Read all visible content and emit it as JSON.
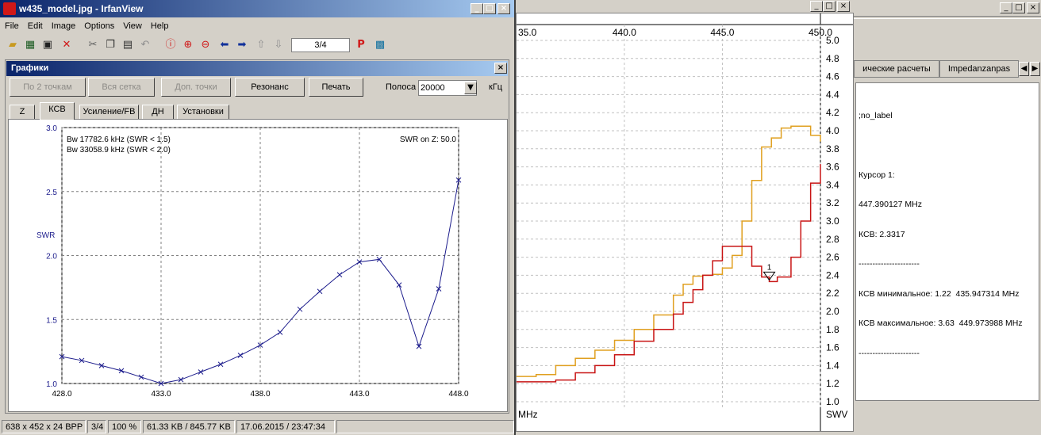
{
  "main_window": {
    "title": "w435_model.jpg - IrfanView",
    "menu": [
      "File",
      "Edit",
      "Image",
      "Options",
      "View",
      "Help"
    ],
    "toolbar": {
      "page_counter": "3/4",
      "icons": [
        "open-icon",
        "thumbnails-icon",
        "save-icon",
        "delete-icon",
        "cut-icon",
        "copy-icon",
        "paste-icon",
        "undo-icon",
        "info-icon",
        "zoom-in-icon",
        "zoom-out-icon",
        "previous-icon",
        "next-icon",
        "first-icon",
        "last-icon",
        "paint-icon",
        "effects-icon"
      ]
    },
    "status_bar": [
      "638 x 452 x 24 BPP",
      "3/4",
      "100 %",
      "61.33 KB / 845.77 KB",
      "17.06.2015 / 23:47:34"
    ]
  },
  "graphs_panel": {
    "title": "Графики",
    "buttons": [
      "По 2 точкам",
      "Вся сетка",
      "Доп. точки",
      "Резонанс",
      "Печать"
    ],
    "band_label": "Полоса",
    "band_value": "20000",
    "band_unit": "кГц",
    "tabs": [
      "Z",
      "КСВ",
      "Усиление/FB",
      "ДН",
      "Установки"
    ],
    "active_tab": "КСВ"
  },
  "chart_data": [
    {
      "type": "line",
      "title": "",
      "ylabel": "SWR",
      "xlabel": "",
      "xlim": [
        428.0,
        448.0
      ],
      "ylim": [
        1.0,
        3.0
      ],
      "xticks": [
        "428.0",
        "433.0",
        "438.0",
        "443.0",
        "448.0"
      ],
      "yticks": [
        "1.0",
        "1.5",
        "2.0",
        "2.5",
        "3.0"
      ],
      "grid": true,
      "annotations": [
        "Bw 17782.6 kHz (SWR < 1.5)",
        "Bw 33058.9 kHz (SWR < 2.0)",
        "SWR on Z: 50.0"
      ],
      "color": "#1c1c8c",
      "x": [
        428.0,
        429.0,
        430.0,
        431.0,
        432.0,
        433.0,
        434.0,
        435.0,
        436.0,
        437.0,
        438.0,
        439.0,
        440.0,
        441.0,
        442.0,
        443.0,
        444.0,
        445.0,
        446.0,
        447.0,
        448.0
      ],
      "y": [
        1.21,
        1.18,
        1.14,
        1.1,
        1.05,
        1.0,
        1.03,
        1.09,
        1.15,
        1.22,
        1.3,
        1.4,
        1.58,
        1.72,
        1.85,
        1.95,
        1.97,
        1.77,
        1.29,
        1.74,
        2.59
      ]
    },
    {
      "type": "line",
      "title": "",
      "xlabel": "MHz",
      "ylabel": "SWV",
      "xlim": [
        434.5,
        450.0
      ],
      "ylim": [
        1.0,
        5.0
      ],
      "xticks": [
        "35.0",
        "440.0",
        "445.0",
        "450.0"
      ],
      "yticks": [
        "1.0",
        "1.2",
        "1.4",
        "1.6",
        "1.8",
        "2.0",
        "2.2",
        "2.4",
        "2.6",
        "2.8",
        "3.0",
        "3.2",
        "3.4",
        "3.6",
        "3.8",
        "4.0",
        "4.2",
        "4.4",
        "4.6",
        "4.8",
        "5.0"
      ],
      "grid": true,
      "marker_label": "1",
      "series": [
        {
          "color": "#e0a020",
          "x": [
            434.5,
            435.5,
            436.5,
            437.5,
            438.5,
            439.5,
            440.5,
            441.5,
            442.5,
            443.0,
            443.5,
            444.0,
            444.5,
            445.0,
            445.5,
            446.0,
            446.5,
            447.0,
            447.5,
            448.0,
            448.5,
            449.0,
            449.5,
            450.0
          ],
          "y": [
            1.28,
            1.3,
            1.4,
            1.48,
            1.57,
            1.68,
            1.8,
            1.96,
            2.18,
            2.3,
            2.39,
            2.4,
            2.41,
            2.48,
            2.62,
            3.0,
            3.45,
            3.82,
            3.92,
            4.03,
            4.05,
            4.05,
            3.95,
            3.88
          ]
        },
        {
          "color": "#c81414",
          "x": [
            434.5,
            435.5,
            436.5,
            437.5,
            438.5,
            439.5,
            440.5,
            441.5,
            442.5,
            443.0,
            443.5,
            444.0,
            444.5,
            445.0,
            445.5,
            446.0,
            446.5,
            447.0,
            447.39,
            447.8,
            448.5,
            449.0,
            449.5,
            450.0
          ],
          "y": [
            1.22,
            1.22,
            1.24,
            1.32,
            1.4,
            1.52,
            1.67,
            1.8,
            1.97,
            2.1,
            2.24,
            2.4,
            2.56,
            2.72,
            2.72,
            2.72,
            2.5,
            2.38,
            2.33,
            2.38,
            2.6,
            3.0,
            3.42,
            3.63
          ]
        }
      ]
    }
  ],
  "side_panel": {
    "tabs": [
      "ические расчеты",
      "Impedanzanpas"
    ],
    "info_lines": [
      ";no_label",
      "",
      "Курсор 1:",
      "447.390127 MHz",
      "КСВ: 2.3317",
      "----------------------",
      "КСВ минимальное: 1.22  435.947314 MHz",
      "КСВ максимальное: 3.63  449.973988 MHz",
      "----------------------"
    ]
  }
}
